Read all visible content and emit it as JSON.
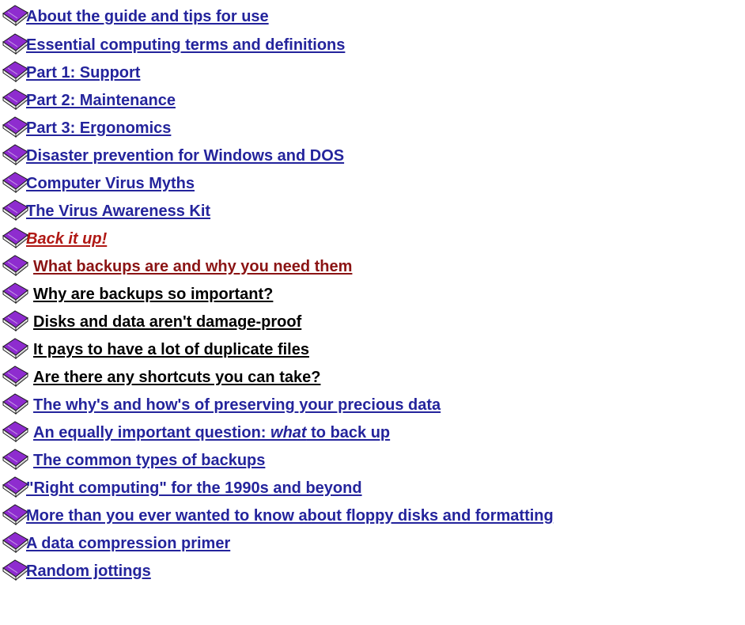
{
  "colors": {
    "link": "#24249c",
    "subtopic": "#000000",
    "active": "#b01814",
    "highlight": "#8b1414",
    "book_cover": "#8e2ccf",
    "book_pages": "#ffffff"
  },
  "icon": "book-icon",
  "toc": {
    "items": [
      {
        "label": "About the guide and tips for use"
      },
      {
        "label": "Essential computing terms and definitions"
      },
      {
        "label": "Part 1: Support"
      },
      {
        "label": "Part 2: Maintenance"
      },
      {
        "label": "Part 3: Ergonomics"
      },
      {
        "label": "Disaster prevention for Windows and DOS"
      },
      {
        "label": "Computer Virus Myths"
      },
      {
        "label": "The Virus Awareness Kit"
      },
      {
        "label": "Back it up!"
      },
      {
        "label": "What backups are and why you need them"
      },
      {
        "label": "Why are backups so important?"
      },
      {
        "label": "Disks and data aren't damage-proof"
      },
      {
        "label": "It pays to have a lot of duplicate files"
      },
      {
        "label": "Are there any shortcuts you can take?"
      },
      {
        "label": "The why's and how's of preserving your precious data"
      },
      {
        "label_a": "An equally important question: ",
        "label_em": "what",
        "label_b": " to back up"
      },
      {
        "label": "The common types of backups"
      },
      {
        "label": "\"Right computing\" for the 1990s and beyond"
      },
      {
        "label": "More than you ever wanted to know about floppy disks and formatting"
      },
      {
        "label": "A data compression primer"
      },
      {
        "label": "Random jottings"
      }
    ]
  }
}
